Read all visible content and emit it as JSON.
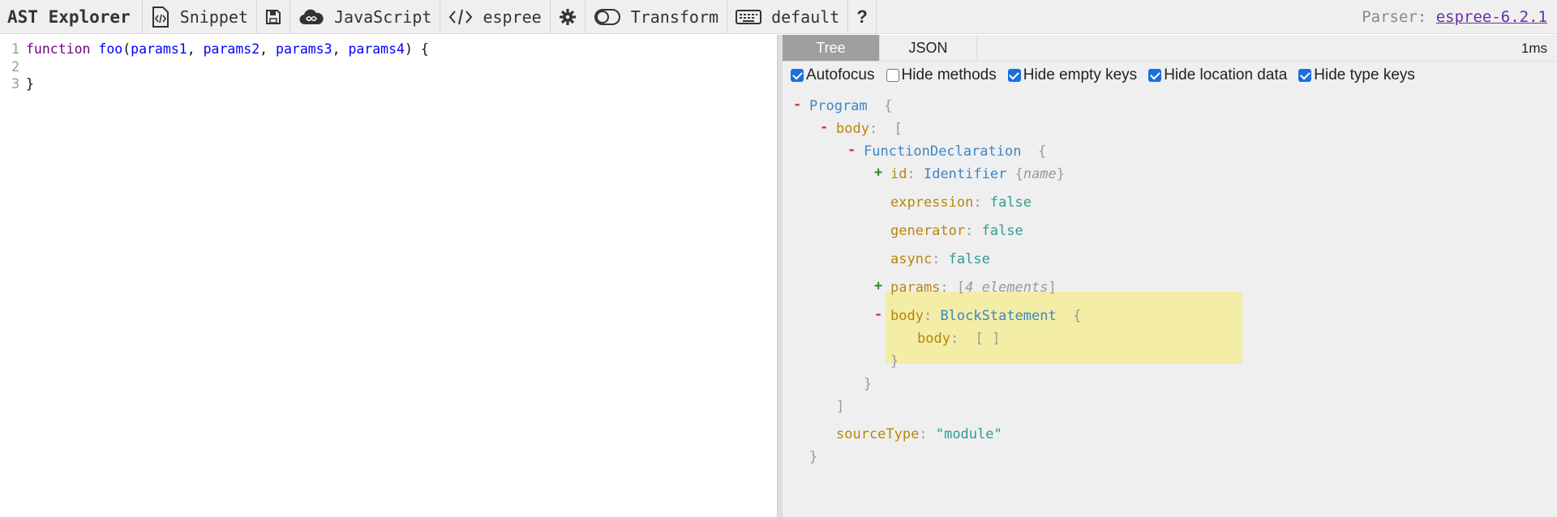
{
  "toolbar": {
    "brand": "AST Explorer",
    "items": [
      {
        "icon": "snippet-icon",
        "label": "Snippet"
      },
      {
        "icon": "save-icon",
        "label": ""
      },
      {
        "icon": "cloud-icon",
        "label": "JavaScript"
      },
      {
        "icon": "code-icon",
        "label": "espree"
      },
      {
        "icon": "gear-icon",
        "label": ""
      },
      {
        "icon": "toggle-icon",
        "label": "Transform"
      },
      {
        "icon": "keyboard-icon",
        "label": "default"
      },
      {
        "icon": "help-icon",
        "label": "?"
      }
    ],
    "parser_label": "Parser:",
    "parser_link": "espree-6.2.1"
  },
  "editor": {
    "lines": [
      {
        "num": "1",
        "tokens": [
          "function",
          "foo",
          "(",
          "params1",
          ", ",
          "params2",
          ", ",
          "params3",
          ", ",
          "params4",
          ") {"
        ]
      },
      {
        "num": "2"
      },
      {
        "num": "3",
        "text": "}"
      }
    ]
  },
  "output": {
    "tabs": [
      "Tree",
      "JSON"
    ],
    "active_tab": "Tree",
    "timing": "1ms",
    "options": [
      {
        "label": "Autofocus",
        "checked": true
      },
      {
        "label": "Hide methods",
        "checked": false
      },
      {
        "label": "Hide empty keys",
        "checked": true
      },
      {
        "label": "Hide location data",
        "checked": true
      },
      {
        "label": "Hide type keys",
        "checked": true
      }
    ],
    "tree": {
      "program": "Program",
      "body_key": "body",
      "func_decl": "FunctionDeclaration",
      "id_key": "id",
      "id_type": "Identifier",
      "id_note": "name",
      "expression_key": "expression",
      "expression_val": "false",
      "generator_key": "generator",
      "generator_val": "false",
      "async_key": "async",
      "async_val": "false",
      "params_key": "params",
      "params_note": "4 elements",
      "body2_key": "body",
      "body2_type": "BlockStatement",
      "body3_key": "body",
      "sourcetype_key": "sourceType",
      "sourcetype_val": "\"module\""
    },
    "colors": {
      "highlight": "#f3eda6",
      "collapse": "#d63a2f",
      "expand": "#2f8a2f"
    }
  }
}
